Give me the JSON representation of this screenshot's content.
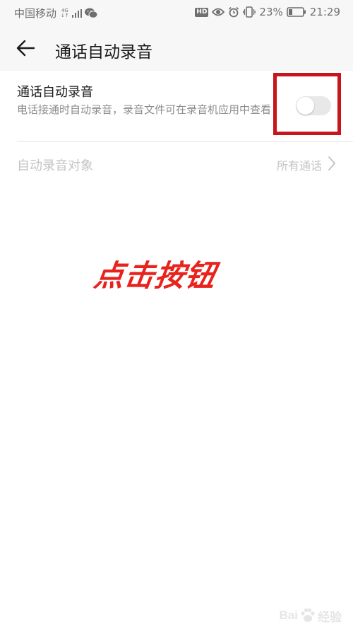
{
  "status_bar": {
    "carrier": "中国移动",
    "network": "4G",
    "battery": "23%",
    "time": "21:29",
    "hd": "HD"
  },
  "header": {
    "title": "通话自动录音"
  },
  "settings": {
    "auto_record": {
      "title": "通话自动录音",
      "description": "电话接通时自动录音，录音文件可在录音机应用中查看",
      "enabled": false
    },
    "record_target": {
      "label": "自动录音对象",
      "value": "所有通话"
    }
  },
  "annotation": {
    "text": "点击按钮",
    "color": "#e8231d",
    "highlight_color": "#c8141b"
  },
  "watermark": {
    "text_left": "Bai",
    "text_right": "经验"
  },
  "icons": [
    "signal-icon",
    "wechat-icon",
    "hd-icon",
    "eye-icon",
    "alarm-icon",
    "vibrate-icon",
    "battery-icon",
    "back-arrow-icon",
    "chevron-right-icon",
    "baidu-paw-icon"
  ]
}
